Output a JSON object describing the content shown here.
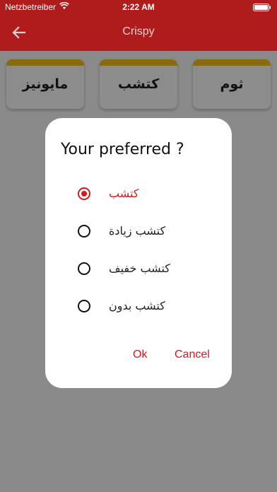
{
  "status_bar": {
    "carrier": "Netzbetreiber",
    "time": "2:22 AM"
  },
  "app_bar": {
    "title": "Crispy"
  },
  "chips": [
    {
      "label": "مايونيز"
    },
    {
      "label": "كتشب"
    },
    {
      "label": "ثوم"
    }
  ],
  "dialog": {
    "title": "Your preferred ?",
    "options": [
      {
        "label": "كتشب",
        "selected": true
      },
      {
        "label": "كتشب زيادة",
        "selected": false
      },
      {
        "label": "كتشب خفيف",
        "selected": false
      },
      {
        "label": "كتشب بدون",
        "selected": false
      }
    ],
    "ok_label": "Ok",
    "cancel_label": "Cancel"
  },
  "colors": {
    "accent": "#d21a1a",
    "app_bar": "#b01c1c",
    "chip_bar": "#f0b400"
  }
}
